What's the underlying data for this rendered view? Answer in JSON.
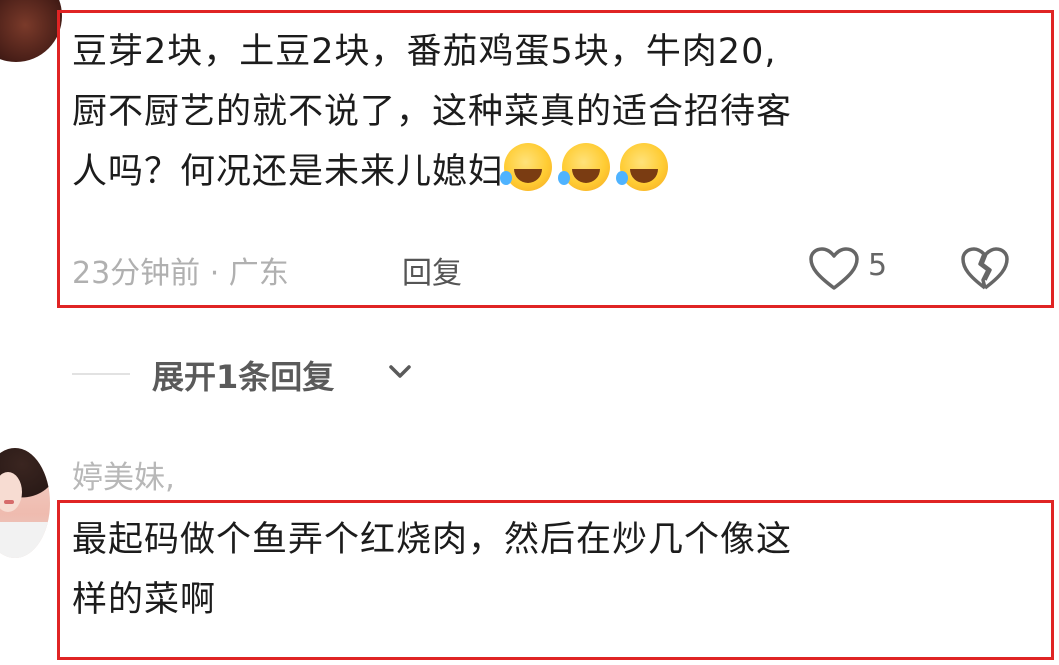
{
  "comment1": {
    "lines": [
      "豆芽2块，土豆2块，番茄鸡蛋5块，牛肉20,",
      "厨不厨艺的就不说了，这种菜真的适合招待客",
      "人吗？何况还是未来儿媳妇"
    ],
    "emoji_count": 3,
    "emoji_name": "rolling-on-floor-laughing",
    "meta": "23分钟前 · 广东",
    "reply_label": "回复",
    "like_count": "5"
  },
  "expand_replies": {
    "label": "展开1条回复"
  },
  "comment2": {
    "username": "婷美妹,",
    "lines": [
      "最起码做个鱼弄个红烧肉，然后在炒几个像这",
      "样的菜啊"
    ]
  },
  "colors": {
    "highlight_border": "#e02424",
    "text": "#1c1c1c",
    "meta": "#b0b0b0"
  }
}
